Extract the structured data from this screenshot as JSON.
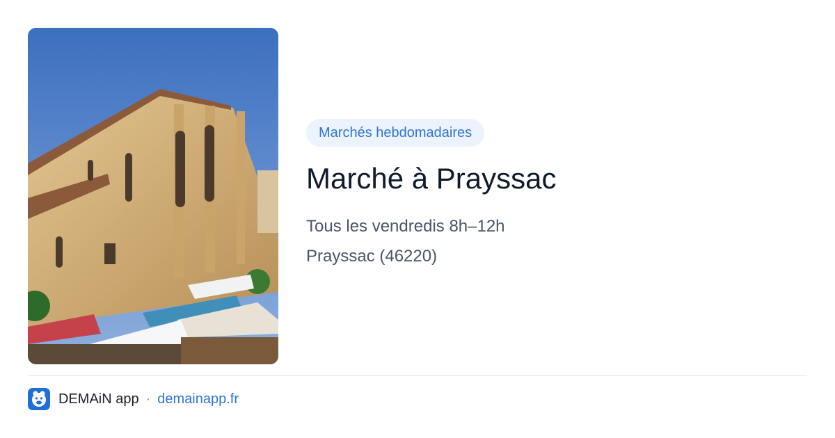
{
  "photo": {
    "alt_label": "Église de Prayssac"
  },
  "card": {
    "tag": "Marchés hebdomadaires",
    "title": "Marché à Prayssac",
    "schedule": "Tous les vendredis 8h–12h",
    "place": "Prayssac (46220)"
  },
  "footer": {
    "app_name": "DEMAiN app",
    "separator": "·",
    "site": "demainapp.fr"
  },
  "colors": {
    "accent": "#2f74d8",
    "tag_background": "#edf3fc",
    "title": "#0f1b2d",
    "text_muted": "#4a5568"
  }
}
